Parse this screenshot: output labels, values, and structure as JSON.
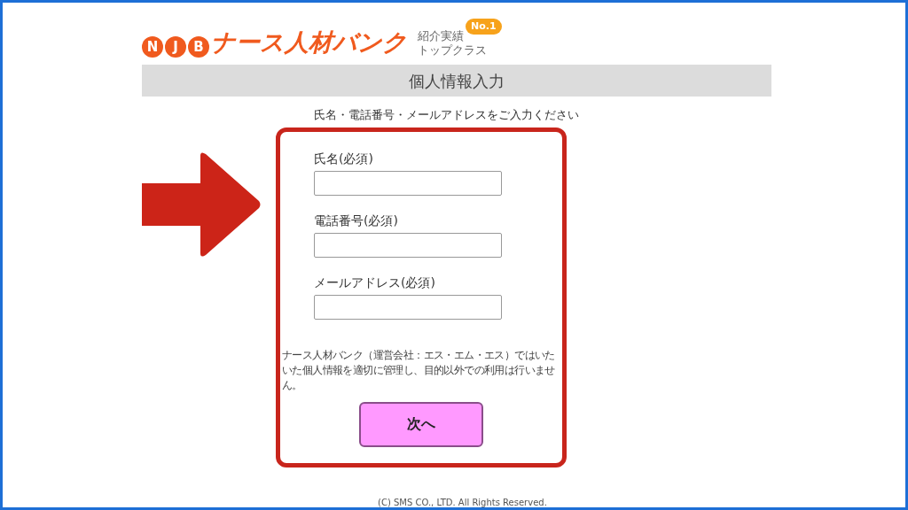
{
  "logo": {
    "letters": [
      "N",
      "J",
      "B"
    ],
    "name": "ナース人材バンク",
    "tagline": [
      "紹介実績",
      "トップクラス"
    ],
    "badge": "No.1"
  },
  "header": {
    "title": "個人情報入力"
  },
  "instruction": "氏名・電話番号・メールアドレスをご入力ください",
  "form": {
    "fields": [
      {
        "label": "氏名(必須)"
      },
      {
        "label": "電話番号(必須)"
      },
      {
        "label": "メールアドレス(必須)"
      }
    ],
    "notice_lines": [
      "ナース人材バンク（運営会社：エス・エム・エス）ではいた",
      "いた個人情報を適切に管理し、目的以外での利用は行いませ",
      "ん。"
    ],
    "submit": "次へ"
  },
  "footer": "(C) SMS CO., LTD. All Rights Reserved."
}
